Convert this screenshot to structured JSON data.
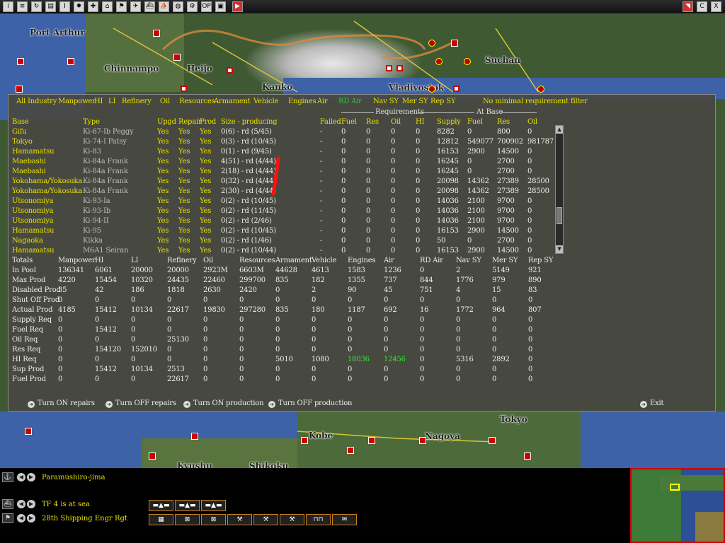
{
  "toolbar": {
    "icons": [
      "info-icon",
      "list-icon",
      "loop-icon",
      "report-icon",
      "intel-icon",
      "japan-flag-icon",
      "medal-icon",
      "factory-icon",
      "flag-icon",
      "aircraft-icon",
      "ship-icon",
      "ship-group-icon",
      "globe-icon",
      "settings-icon",
      "op-icon",
      "image-icon",
      "play-icon"
    ],
    "right_icons": [
      "back-icon",
      "close-icon",
      "exit-icon"
    ],
    "op_label": "OP",
    "c_label": "C",
    "x_label": "X"
  },
  "map": {
    "cities": [
      "Port Arthur",
      "Chinnampo",
      "Heijo",
      "Kanko",
      "Vladivostok",
      "Suchan",
      "Kobe",
      "Nagoya",
      "Tokyo",
      "Kyushu",
      "Shikoku"
    ]
  },
  "filters": [
    {
      "label": "All Industry",
      "active": false
    },
    {
      "label": "Manpower",
      "active": false
    },
    {
      "label": "HI",
      "active": false
    },
    {
      "label": "LI",
      "active": false
    },
    {
      "label": "Refinery",
      "active": false
    },
    {
      "label": "Oil",
      "active": false
    },
    {
      "label": "Resources",
      "active": false
    },
    {
      "label": "Armament",
      "active": false
    },
    {
      "label": "Vehicle",
      "active": false
    },
    {
      "label": "Engines",
      "active": false
    },
    {
      "label": "Air",
      "active": false
    },
    {
      "label": "RD Air",
      "active": true
    },
    {
      "label": "Nav SY",
      "active": false
    },
    {
      "label": "Mer SY",
      "active": false
    },
    {
      "label": "Rep SY",
      "active": false
    },
    {
      "label": "No minimal requirement filter",
      "active": false
    }
  ],
  "group_labels": {
    "requirements": "Requirements",
    "at_base": "At Base"
  },
  "prod_headers": [
    "Base",
    "Type",
    "Upgd",
    "Repair",
    "Prod",
    "Size - producing",
    "Failed",
    "Fuel",
    "Res",
    "Oil",
    "HI",
    "Supply",
    "Fuel",
    "Res",
    "Oil"
  ],
  "prod_rows": [
    [
      "Gifu",
      "Ki-67-Ib Peggy",
      "Yes",
      "Yes",
      "Yes",
      "0(6) - rd (5/45)",
      "-",
      "0",
      "0",
      "0",
      "0",
      "8282",
      "0",
      "800",
      "0"
    ],
    [
      "Tokyo",
      "Ki-74-I Patsy",
      "Yes",
      "Yes",
      "Yes",
      "0(3) - rd (10/45)",
      "-",
      "0",
      "0",
      "0",
      "0",
      "12812",
      "549077",
      "700902",
      "981787"
    ],
    [
      "Hamamatsu",
      "Ki-83",
      "Yes",
      "Yes",
      "Yes",
      "0(1) - rd (9/45)",
      "-",
      "0",
      "0",
      "0",
      "0",
      "16153",
      "2900",
      "14500",
      "0"
    ],
    [
      "Maebashi",
      "Ki-84a Frank",
      "Yes",
      "Yes",
      "Yes",
      "4(51) - rd (4/44)",
      "-",
      "0",
      "0",
      "0",
      "0",
      "16245",
      "0",
      "2700",
      "0"
    ],
    [
      "Maebashi",
      "Ki-84a Frank",
      "Yes",
      "Yes",
      "Yes",
      "2(18) - rd (4/44)",
      "-",
      "0",
      "0",
      "0",
      "0",
      "16245",
      "0",
      "2700",
      "0"
    ],
    [
      "Yokohama/Yokosuka",
      "Ki-84a Frank",
      "Yes",
      "Yes",
      "Yes",
      "0(32) - rd (4/44)",
      "-",
      "0",
      "0",
      "0",
      "0",
      "20098",
      "14362",
      "27389",
      "28500"
    ],
    [
      "Yokohama/Yokosuka",
      "Ki-84a Frank",
      "Yes",
      "Yes",
      "Yes",
      "2(30) - rd (4/44)",
      "-",
      "0",
      "0",
      "0",
      "0",
      "20098",
      "14362",
      "27389",
      "28500"
    ],
    [
      "Utsonomiya",
      "Ki-93-Ia",
      "Yes",
      "Yes",
      "Yes",
      "0(2) - rd (10/45)",
      "-",
      "0",
      "0",
      "0",
      "0",
      "14036",
      "2100",
      "9700",
      "0"
    ],
    [
      "Utsonomiya",
      "Ki-93-Ib",
      "Yes",
      "Yes",
      "Yes",
      "0(2) - rd (11/45)",
      "-",
      "0",
      "0",
      "0",
      "0",
      "14036",
      "2100",
      "9700",
      "0"
    ],
    [
      "Utsonomiya",
      "Ki-94-II",
      "Yes",
      "Yes",
      "Yes",
      "0(2) - rd (2/46)",
      "-",
      "0",
      "0",
      "0",
      "0",
      "14036",
      "2100",
      "9700",
      "0"
    ],
    [
      "Hamamatsu",
      "Ki-95",
      "Yes",
      "Yes",
      "Yes",
      "0(2) - rd (10/45)",
      "-",
      "0",
      "0",
      "0",
      "0",
      "16153",
      "2900",
      "14500",
      "0"
    ],
    [
      "Nagaoka",
      "Kikka",
      "Yes",
      "Yes",
      "Yes",
      "0(2) - rd (1/46)",
      "-",
      "0",
      "0",
      "0",
      "0",
      "50",
      "0",
      "2700",
      "0"
    ],
    [
      "Hamamatsu",
      "M6A1 Seiran",
      "Yes",
      "Yes",
      "Yes",
      "0(2) - rd (10/44)",
      "-",
      "0",
      "0",
      "0",
      "0",
      "16153",
      "2900",
      "14500",
      "0"
    ]
  ],
  "totals_headers": [
    "Totals",
    "Manpower",
    "HI",
    "LI",
    "Refinery",
    "Oil",
    "Resources",
    "Armament",
    "Vehicle",
    "Engines",
    "Air",
    "RD Air",
    "Nav SY",
    "Mer SY",
    "Rep SY"
  ],
  "totals_rows": [
    [
      "In Pool",
      "136341",
      "6061",
      "20000",
      "20000",
      "2923M",
      "6603M",
      "44628",
      "4613",
      "1583",
      "1236",
      "0",
      "2",
      "5149",
      "921"
    ],
    [
      "Max Prod",
      "4220",
      "15454",
      "10320",
      "24435",
      "22460",
      "299700",
      "835",
      "182",
      "1355",
      "737",
      "844",
      "1776",
      "979",
      "890"
    ],
    [
      "Disabled Prod",
      "35",
      "42",
      "186",
      "1818",
      "2630",
      "2420",
      "0",
      "2",
      "90",
      "45",
      "751",
      "4",
      "15",
      "83"
    ],
    [
      "Shut Off Prod",
      "0",
      "0",
      "0",
      "0",
      "0",
      "0",
      "0",
      "0",
      "0",
      "0",
      "0",
      "0",
      "0",
      "0"
    ],
    [
      "Actual Prod",
      "4185",
      "15412",
      "10134",
      "22617",
      "19830",
      "297280",
      "835",
      "180",
      "1187",
      "692",
      "16",
      "1772",
      "964",
      "807"
    ],
    [
      "Supply Req",
      "0",
      "0",
      "0",
      "0",
      "0",
      "0",
      "0",
      "0",
      "0",
      "0",
      "0",
      "0",
      "0",
      "0"
    ],
    [
      "Fuel Req",
      "0",
      "15412",
      "0",
      "0",
      "0",
      "0",
      "0",
      "0",
      "0",
      "0",
      "0",
      "0",
      "0",
      "0"
    ],
    [
      "Oil Req",
      "0",
      "0",
      "0",
      "25130",
      "0",
      "0",
      "0",
      "0",
      "0",
      "0",
      "0",
      "0",
      "0",
      "0"
    ],
    [
      "Res Req",
      "0",
      "154120",
      "152010",
      "0",
      "0",
      "0",
      "0",
      "0",
      "0",
      "0",
      "0",
      "0",
      "0",
      "0"
    ],
    [
      "HI Req",
      "0",
      "0",
      "0",
      "0",
      "0",
      "0",
      "5010",
      "1080",
      "18036",
      "12456",
      "0",
      "5316",
      "2892",
      "0"
    ],
    [
      "Sup Prod",
      "0",
      "15412",
      "10134",
      "2513",
      "0",
      "0",
      "0",
      "0",
      "0",
      "0",
      "0",
      "0",
      "0",
      "0"
    ],
    [
      "Fuel Prod",
      "0",
      "0",
      "0",
      "22617",
      "0",
      "0",
      "0",
      "0",
      "0",
      "0",
      "0",
      "0",
      "0",
      "0"
    ]
  ],
  "actions": {
    "repairs_on": "Turn ON repairs",
    "repairs_off": "Turn OFF repairs",
    "prod_on": "Turn ON production",
    "prod_off": "Turn OFF production",
    "exit": "Exit"
  },
  "bottom": {
    "base": "Paramushiro-jima",
    "tf": "TF 4 is at sea",
    "unit": "28th Shipping Engr Rgt"
  },
  "colors": {
    "panel": "#484842",
    "header": "#e8e000",
    "active": "#2ecc2e",
    "highlight": "#3ce03c",
    "sea": "#3d62a8"
  }
}
